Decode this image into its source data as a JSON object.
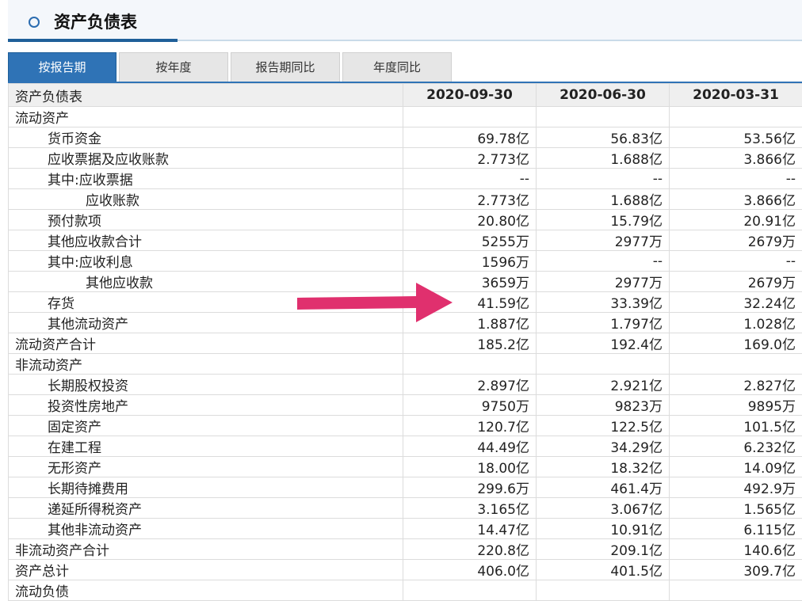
{
  "page_title": "资产负债表",
  "tabs": [
    "按报告期",
    "按年度",
    "报告期同比",
    "年度同比"
  ],
  "active_tab": 0,
  "table": {
    "header": [
      "资产负债表",
      "2020-09-30",
      "2020-06-30",
      "2020-03-31"
    ],
    "rows": [
      {
        "label": "流动资产",
        "level": 0,
        "values": [
          "",
          "",
          ""
        ]
      },
      {
        "label": "货币资金",
        "level": 1,
        "values": [
          "69.78亿",
          "56.83亿",
          "53.56亿"
        ]
      },
      {
        "label": "应收票据及应收账款",
        "level": 1,
        "values": [
          "2.773亿",
          "1.688亿",
          "3.866亿"
        ]
      },
      {
        "label": "其中:应收票据",
        "level": 1,
        "values": [
          "--",
          "--",
          "--"
        ]
      },
      {
        "label": "应收账款",
        "level": 2,
        "values": [
          "2.773亿",
          "1.688亿",
          "3.866亿"
        ]
      },
      {
        "label": "预付款项",
        "level": 1,
        "values": [
          "20.80亿",
          "15.79亿",
          "20.91亿"
        ]
      },
      {
        "label": "其他应收款合计",
        "level": 1,
        "values": [
          "5255万",
          "2977万",
          "2679万"
        ]
      },
      {
        "label": "其中:应收利息",
        "level": 1,
        "values": [
          "1596万",
          "--",
          "--"
        ]
      },
      {
        "label": "其他应收款",
        "level": 2,
        "values": [
          "3659万",
          "2977万",
          "2679万"
        ]
      },
      {
        "label": "存货",
        "level": 1,
        "values": [
          "41.59亿",
          "33.39亿",
          "32.24亿"
        ]
      },
      {
        "label": "其他流动资产",
        "level": 1,
        "values": [
          "1.887亿",
          "1.797亿",
          "1.028亿"
        ]
      },
      {
        "label": "流动资产合计",
        "level": 0,
        "values": [
          "185.2亿",
          "192.4亿",
          "169.0亿"
        ]
      },
      {
        "label": "非流动资产",
        "level": 0,
        "values": [
          "",
          "",
          ""
        ]
      },
      {
        "label": "长期股权投资",
        "level": 1,
        "values": [
          "2.897亿",
          "2.921亿",
          "2.827亿"
        ]
      },
      {
        "label": "投资性房地产",
        "level": 1,
        "values": [
          "9750万",
          "9823万",
          "9895万"
        ]
      },
      {
        "label": "固定资产",
        "level": 1,
        "values": [
          "120.7亿",
          "122.5亿",
          "101.5亿"
        ]
      },
      {
        "label": "在建工程",
        "level": 1,
        "values": [
          "44.49亿",
          "34.29亿",
          "6.232亿"
        ]
      },
      {
        "label": "无形资产",
        "level": 1,
        "values": [
          "18.00亿",
          "18.32亿",
          "14.09亿"
        ]
      },
      {
        "label": "长期待摊费用",
        "level": 1,
        "values": [
          "299.6万",
          "461.4万",
          "492.9万"
        ]
      },
      {
        "label": "递延所得税资产",
        "level": 1,
        "values": [
          "3.165亿",
          "3.067亿",
          "1.565亿"
        ]
      },
      {
        "label": "其他非流动资产",
        "level": 1,
        "values": [
          "14.47亿",
          "10.91亿",
          "6.115亿"
        ]
      },
      {
        "label": "非流动资产合计",
        "level": 0,
        "values": [
          "220.8亿",
          "209.1亿",
          "140.6亿"
        ]
      },
      {
        "label": "资产总计",
        "level": 0,
        "values": [
          "406.0亿",
          "401.5亿",
          "309.7亿"
        ]
      },
      {
        "label": "流动负债",
        "level": 0,
        "values": [
          "",
          "",
          ""
        ]
      }
    ]
  },
  "colors": {
    "accent": "#2f73b6",
    "arrow": "#e0306e"
  },
  "annotation": {
    "icon": "arrow-right-icon"
  }
}
